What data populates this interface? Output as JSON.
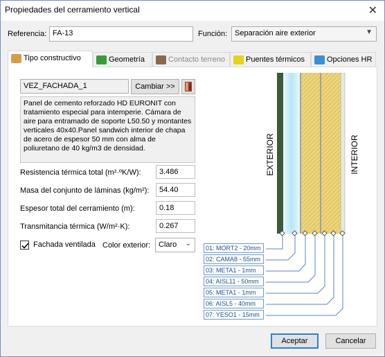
{
  "window": {
    "title": "Propiedades del cerramiento vertical",
    "close_glyph": "✕"
  },
  "header": {
    "referencia_label": "Referencia:",
    "referencia_value": "FA-13",
    "funcion_label": "Función:",
    "funcion_value": "Separación aire exterior"
  },
  "tabs": [
    {
      "label": "Tipo constructivo",
      "icon": "construction-type-icon",
      "color": "#d79b4a",
      "active": true,
      "disabled": false
    },
    {
      "label": "Geometría",
      "icon": "geometry-icon",
      "color": "#3a9b3a",
      "active": false,
      "disabled": false
    },
    {
      "label": "Contacto terreno",
      "icon": "ground-contact-icon",
      "color": "#8a6a4a",
      "active": false,
      "disabled": true
    },
    {
      "label": "Puentes térmicos",
      "icon": "thermal-bridge-icon",
      "color": "#e6d21a",
      "active": false,
      "disabled": false
    },
    {
      "label": "Opciones HR",
      "icon": "hr-options-icon",
      "color": "#3b8fd6",
      "active": false,
      "disabled": false
    }
  ],
  "construction": {
    "name": "VEZ_FACHADA_1",
    "change_button": "Cambiar >>",
    "description": "Panel de cemento reforzado HD EURONIT con tratamiento especial para intemperie. Cámara de aire para entramado de soporte L50.50 y montantes verticales 40x40.Panel sandwich interior de chapa de acero de espesor 50 mm con alma de poliuretano de 40 kg/m3 de densidad."
  },
  "properties": [
    {
      "label": "Resistencia térmica total  (m²·ºK/W):",
      "value": "3.486"
    },
    {
      "label": "Masa del conjunto de láminas (kg/m²):",
      "value": "54.40"
    },
    {
      "label": "Espesor total del cerramiento (m):",
      "value": "0.18"
    },
    {
      "label": "Transmitancia térmica (W/m²·K):",
      "value": "0.267"
    }
  ],
  "options": {
    "ventilated_label": "Fachada ventilada",
    "ventilated_checked": true,
    "color_label": "Color exterior:",
    "color_value": "Claro"
  },
  "diagram": {
    "exterior_label": "EXTERIOR",
    "interior_label": "INTERIOR",
    "layers": [
      "01: MORT2 - 20mm",
      "02: CAMA8 - 55mm",
      "03: META1 - 1mm",
      "04: AISL11 - 50mm",
      "05: META1 - 1mm",
      "06: AISL5 - 40mm",
      "07: YESO1 - 15mm"
    ]
  },
  "footer": {
    "accept": "Aceptar",
    "cancel": "Cancelar"
  },
  "colors": {
    "accent": "#2f7dd4",
    "insulation": "#e8d27a",
    "air_gap": "#cdeefa",
    "mortar": "#3a5a3a"
  }
}
